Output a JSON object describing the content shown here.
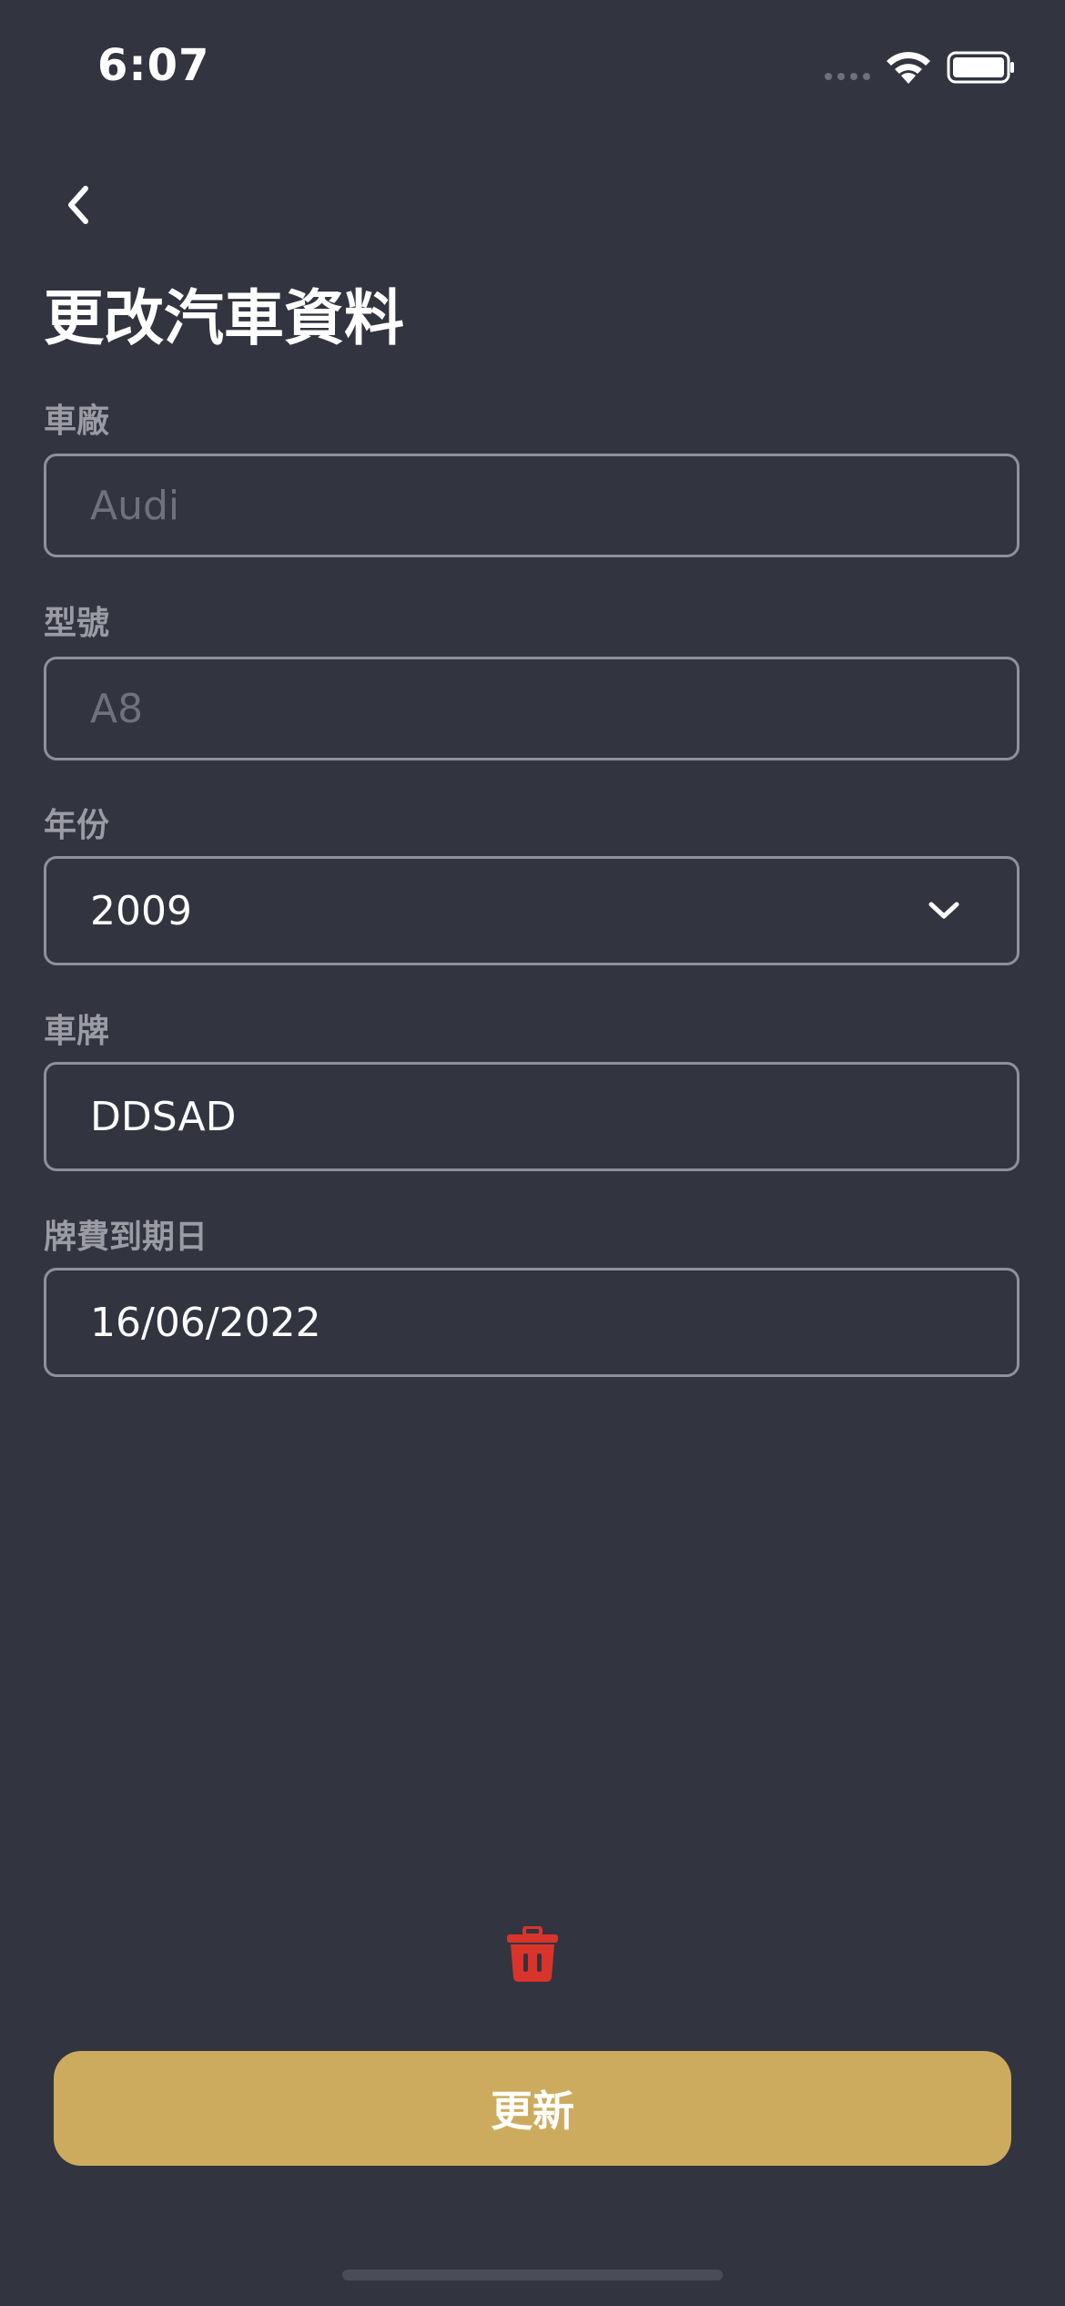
{
  "status_bar": {
    "time": "6:07"
  },
  "header": {
    "back_icon": "chevron-left-icon",
    "title": "更改汽車資料"
  },
  "form": {
    "make": {
      "label": "車廠",
      "placeholder": "Audi",
      "value": ""
    },
    "model": {
      "label": "型號",
      "placeholder": "A8",
      "value": ""
    },
    "year": {
      "label": "年份",
      "value": "2009",
      "icon": "chevron-down-icon"
    },
    "plate": {
      "label": "車牌",
      "value": "DDSAD"
    },
    "license_expiry": {
      "label": "牌費到期日",
      "value": "16/06/2022"
    }
  },
  "actions": {
    "delete_icon": "trash-icon",
    "update_label": "更新"
  },
  "colors": {
    "background": "#323440",
    "accent": "#cdab5e",
    "danger": "#d9342b",
    "border": "#8f909a",
    "label": "#9a9ba3",
    "placeholder": "#6f717c"
  }
}
